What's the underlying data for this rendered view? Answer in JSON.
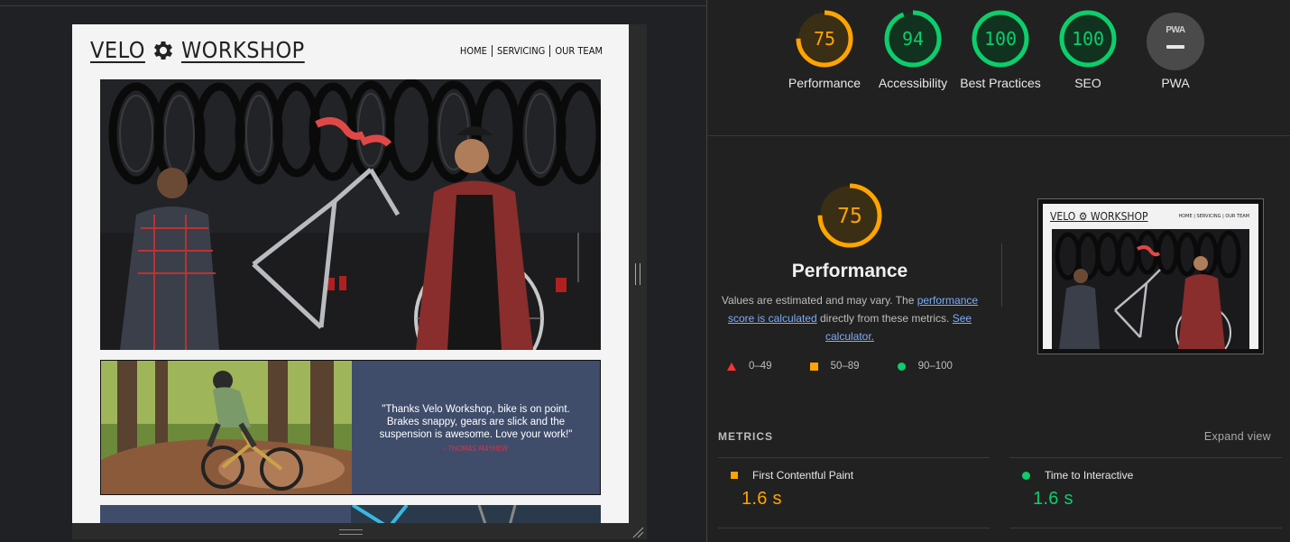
{
  "site": {
    "logo_left": "VELO",
    "logo_right": "WORKSHOP",
    "logo_icon": "gear-icon",
    "nav": [
      "HOME",
      "SERVICING",
      "OUR TEAM"
    ],
    "testimonial_quote": "\"Thanks Velo Workshop, bike is on point. Brakes snappy, gears are slick and the suspension is awesome. Love your work!\"",
    "testimonial_author": "- THOMAS MAYHEW"
  },
  "scores": [
    {
      "label": "Performance",
      "value": "75",
      "status": "average"
    },
    {
      "label": "Accessibility",
      "value": "94",
      "status": "pass"
    },
    {
      "label": "Best Practices",
      "value": "100",
      "status": "pass"
    },
    {
      "label": "SEO",
      "value": "100",
      "status": "pass"
    },
    {
      "label": "PWA",
      "value": "",
      "status": "na",
      "badge_text": "PWA"
    }
  ],
  "performance": {
    "score": "75",
    "title": "Performance",
    "desc_prefix": "Values are estimated and may vary. The ",
    "desc_link1": "performance score is calculated",
    "desc_mid": " directly from these metrics. ",
    "desc_link2": "See calculator.",
    "legend": [
      {
        "shape": "triangle",
        "range": "0–49",
        "color": "#ff3333"
      },
      {
        "shape": "square",
        "range": "50–89",
        "color": "#ffa400"
      },
      {
        "shape": "circle",
        "range": "90–100",
        "color": "#0cce6b"
      }
    ]
  },
  "thumbnail": {
    "logo": "VELO ⚙ WORKSHOP",
    "nav": "HOME | SERVICING | OUR TEAM"
  },
  "metrics": {
    "title": "METRICS",
    "expand_label": "Expand view",
    "items": [
      {
        "name": "First Contentful Paint",
        "value": "1.6 s",
        "status": "average",
        "color": "#ffa400"
      },
      {
        "name": "Time to Interactive",
        "value": "1.6 s",
        "status": "pass",
        "color": "#0cce6b"
      }
    ]
  },
  "colors": {
    "pass": "#0cce6b",
    "average": "#ffa400",
    "fail": "#ff3333",
    "link": "#7cacf8",
    "testimonial_bg": "#3f4d6b"
  }
}
